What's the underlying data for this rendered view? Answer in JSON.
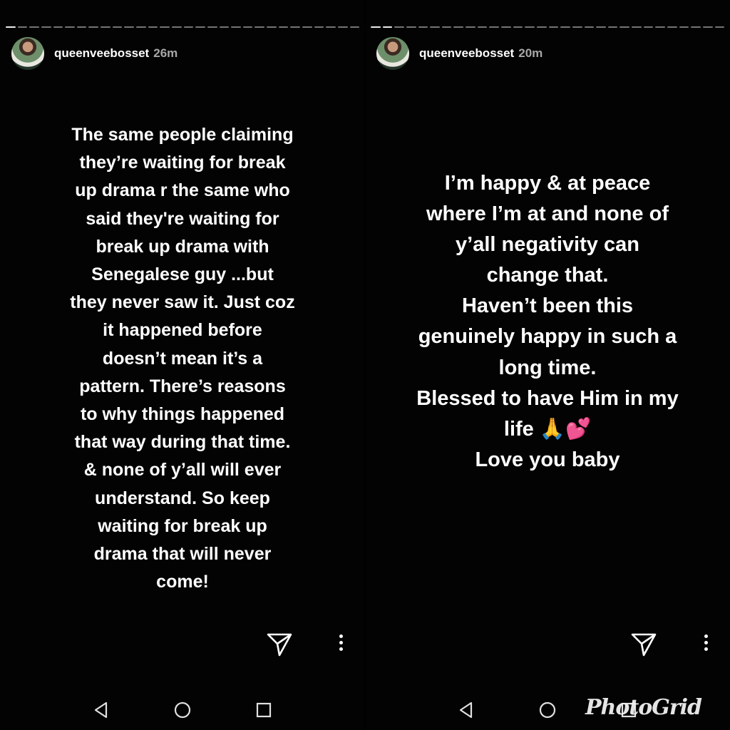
{
  "left_story": {
    "username": "queenveebosset",
    "time": "26m",
    "text": "The same people claiming\nthey’re waiting for break\nup drama r the same who\nsaid they're waiting for\nbreak up drama with\nSenegalese guy ...but\nthey never saw it. Just coz\nit happened before\ndoesn’t mean it’s a\npattern. There’s reasons\nto why things happened\nthat way during that time.\n& none of y’all will ever\nunderstand. So keep\nwaiting for break up\ndrama that will never\ncome!"
  },
  "right_story": {
    "username": "queenveebosset",
    "time": "20m",
    "text": "I’m happy & at peace\nwhere I’m at and none of\ny’all negativity can\nchange that.\nHaven’t been this\ngenuinely happy in such a\nlong time.\nBlessed to have Him in my\nlife 🙏💕\nLove you baby"
  },
  "icons": {
    "send": "send-icon",
    "more": "more-vertical-icon",
    "back": "nav-back-icon",
    "home": "nav-home-icon",
    "recent": "nav-recent-icon"
  },
  "watermark": "PhotoGrid",
  "colors": {
    "background": "#030303",
    "text": "#ffffff"
  }
}
